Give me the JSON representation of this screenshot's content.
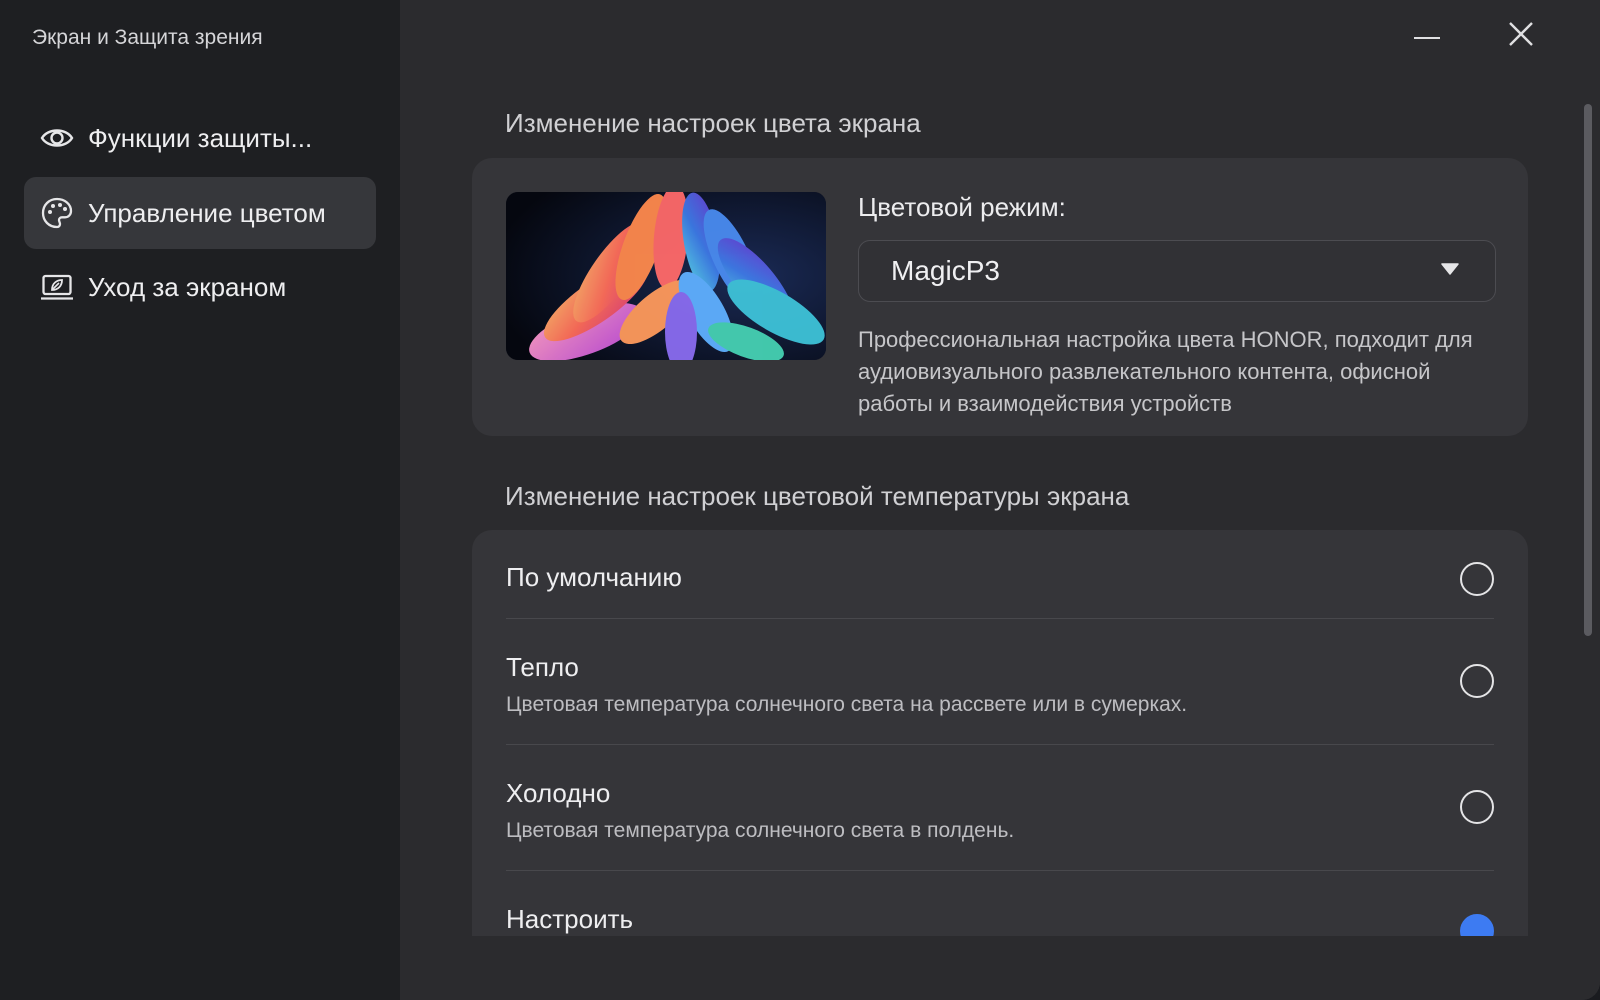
{
  "app": {
    "title": "Экран и Защита зрения"
  },
  "window_controls": {
    "minimize_icon": "minimize-icon",
    "close_icon": "close-icon"
  },
  "sidebar": {
    "items": [
      {
        "label": "Функции защиты...",
        "icon": "eye-icon",
        "active": false
      },
      {
        "label": "Управление цветом",
        "icon": "palette-icon",
        "active": true
      },
      {
        "label": "Уход за экраном",
        "icon": "screen-leaf-icon",
        "active": false
      }
    ]
  },
  "color_section": {
    "title": "Изменение настроек цвета экрана",
    "mode_label": "Цветовой режим:",
    "mode_value": "MagicP3",
    "description": "Профессиональная настройка цвета HONOR, подходит для аудиовизуального развлекательного контента, офисной работы и взаимодействия устройств"
  },
  "temperature_section": {
    "title": "Изменение настроек цветовой температуры экрана",
    "options": [
      {
        "title": "По умолчанию",
        "subtitle": "",
        "selected": false
      },
      {
        "title": "Тепло",
        "subtitle": "Цветовая температура солнечного света на рассвете или в сумерках.",
        "selected": false
      },
      {
        "title": "Холодно",
        "subtitle": "Цветовая температура солнечного света в полдень.",
        "selected": false
      },
      {
        "title": "Настроить",
        "subtitle": "",
        "selected": true
      }
    ]
  },
  "colors": {
    "accent": "#3d7bf2",
    "sidebar_bg": "#1e1f22",
    "main_bg": "#2b2b2e",
    "card_bg": "#353539"
  }
}
